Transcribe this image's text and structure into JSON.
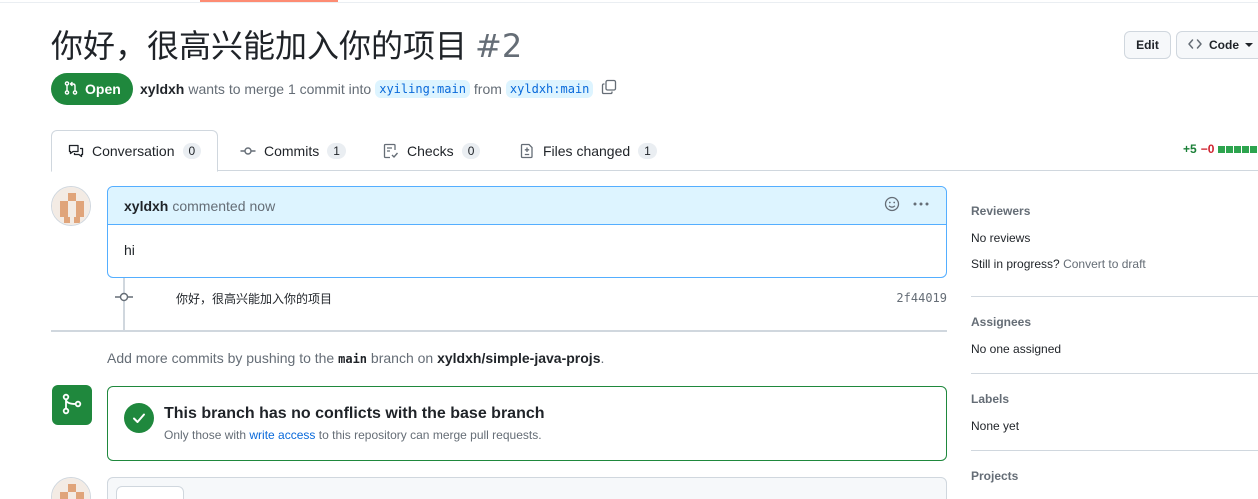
{
  "pr": {
    "title": "你好，很高兴能加入你的项目",
    "number": "#2",
    "state": "Open",
    "author": "xyldxh",
    "meta_text": "wants to merge 1 commit into",
    "base_branch": "xyiling:main",
    "from_text": "from",
    "head_branch": "xyldxh:main"
  },
  "header_buttons": {
    "edit": "Edit",
    "code": "Code"
  },
  "tabs": [
    {
      "label": "Conversation",
      "count": "0"
    },
    {
      "label": "Commits",
      "count": "1"
    },
    {
      "label": "Checks",
      "count": "0"
    },
    {
      "label": "Files changed",
      "count": "1"
    }
  ],
  "diffstat": {
    "additions": "+5",
    "deletions": "−0"
  },
  "comment": {
    "author": "xyldxh",
    "action": "commented",
    "time": "now",
    "body": "hi"
  },
  "commit": {
    "message": "你好，很高兴能加入你的项目",
    "sha": "2f44019"
  },
  "add_commits": {
    "prefix": "Add more commits by pushing to the",
    "branch": "main",
    "middle": "branch on",
    "repo": "xyldxh/simple-java-projs",
    "suffix": "."
  },
  "merge": {
    "title": "This branch has no conflicts with the base branch",
    "sub_prefix": "Only those with",
    "sub_link": "write access",
    "sub_suffix": "to this repository can merge pull requests."
  },
  "sidebar": {
    "reviewers": {
      "heading": "Reviewers",
      "value": "No reviews",
      "progress_text": "Still in progress?",
      "convert_link": "Convert to draft"
    },
    "assignees": {
      "heading": "Assignees",
      "value": "No one assigned"
    },
    "labels": {
      "heading": "Labels",
      "value": "None yet"
    },
    "projects": {
      "heading": "Projects"
    }
  },
  "colors": {
    "open_green": "#1f883d",
    "link_blue": "#0969da",
    "comment_header_bg": "#ddf4ff"
  }
}
